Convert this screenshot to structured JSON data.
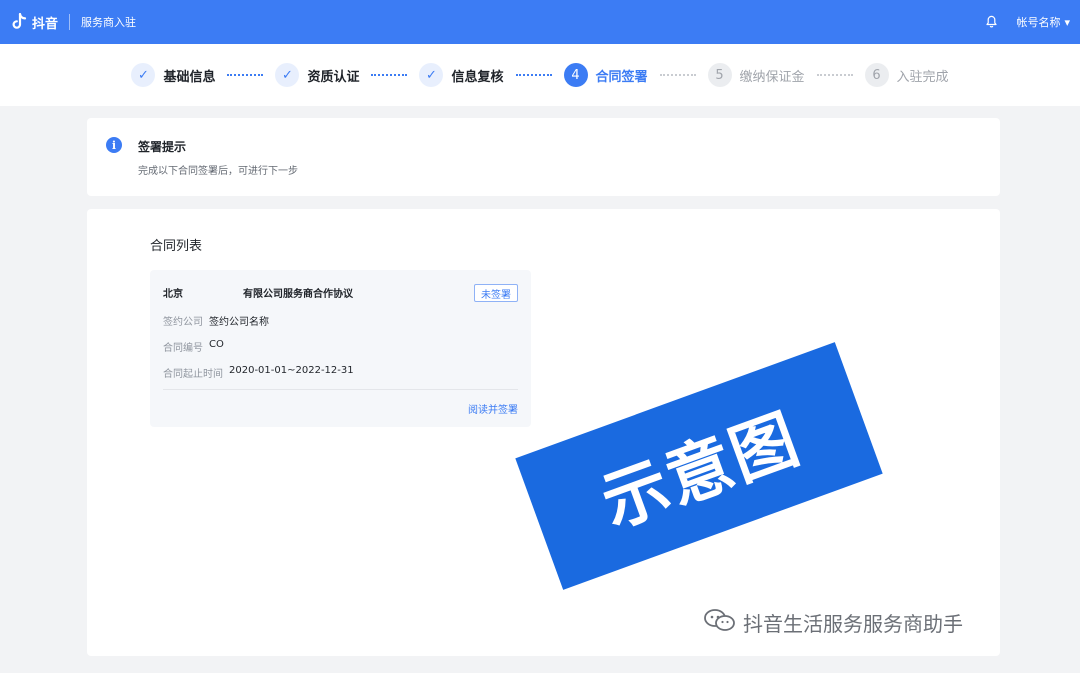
{
  "topbar": {
    "brand": "抖音",
    "subtitle": "服务商入驻",
    "account": "帐号名称",
    "account_caret": "▾"
  },
  "steps": [
    {
      "label": "基础信息",
      "status": "done",
      "marker": "✓"
    },
    {
      "label": "资质认证",
      "status": "done",
      "marker": "✓"
    },
    {
      "label": "信息复核",
      "status": "done",
      "marker": "✓"
    },
    {
      "label": "合同签署",
      "status": "active",
      "marker": "4"
    },
    {
      "label": "缴纳保证金",
      "status": "todo",
      "marker": "5"
    },
    {
      "label": "入驻完成",
      "status": "todo",
      "marker": "6"
    }
  ],
  "notice": {
    "icon": "i",
    "title": "签署提示",
    "desc": "完成以下合同签署后，可进行下一步"
  },
  "contracts": {
    "section_title": "合同列表",
    "items": [
      {
        "name_prefix": "北京",
        "name_suffix": "有限公司服务商合作协议",
        "status": "未签署",
        "company_label": "签约公司",
        "company_value": "签约公司名称",
        "number_label": "合同编号",
        "number_value": "CO",
        "period_label": "合同起止时间",
        "period_value": "2020-01-01~2022-12-31",
        "action": "阅读并签署"
      }
    ]
  },
  "watermark": {
    "stamp_text": "示意图",
    "credit": "抖音生活服务服务商助手"
  },
  "colors": {
    "primary": "#3c7cf4",
    "stamp": "#1a6ae0"
  }
}
